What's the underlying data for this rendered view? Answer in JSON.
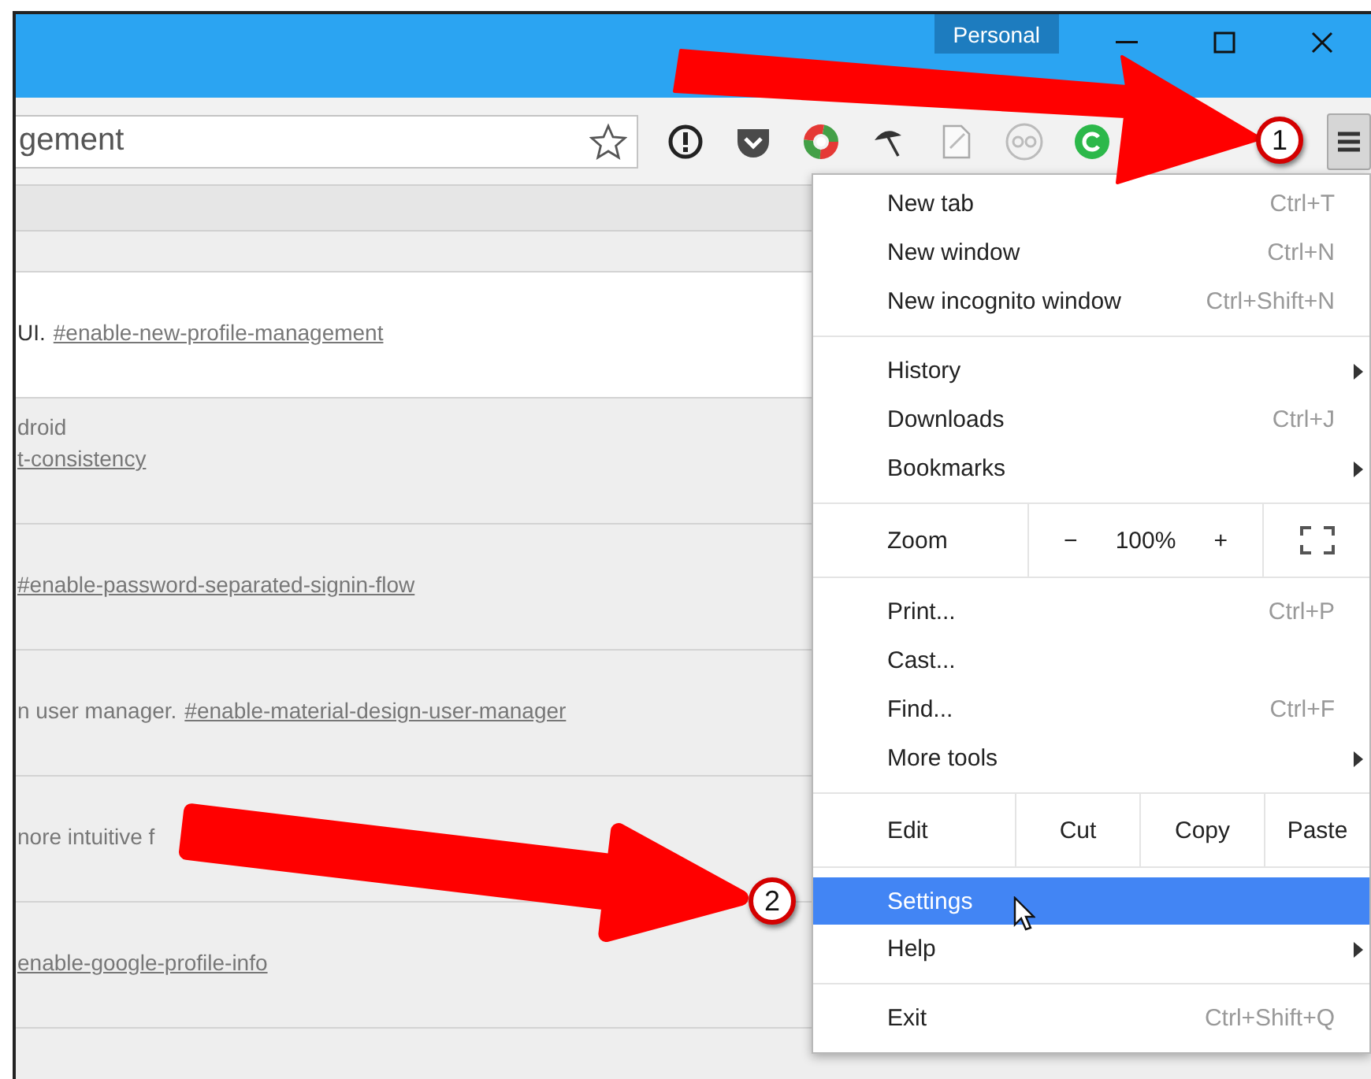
{
  "title_bar": {
    "profile": "Personal"
  },
  "toolbar": {
    "omnibox": {
      "value": "gement"
    }
  },
  "flags": [
    {
      "highlighted": true,
      "lines": [
        [
          {
            "kind": "text",
            "text": "UI."
          },
          {
            "kind": "link",
            "text": "#enable-new-profile-management"
          }
        ]
      ]
    },
    {
      "highlighted": false,
      "lines": [
        [
          {
            "kind": "text",
            "text": "droid"
          }
        ],
        [
          {
            "kind": "link",
            "text": "t-consistency"
          }
        ]
      ]
    },
    {
      "highlighted": false,
      "lines": [
        [
          {
            "kind": "link",
            "text": "#enable-password-separated-signin-flow"
          }
        ]
      ]
    },
    {
      "highlighted": false,
      "lines": [
        [
          {
            "kind": "text",
            "text": "n user manager."
          },
          {
            "kind": "link",
            "text": "#enable-material-design-user-manager"
          }
        ]
      ]
    },
    {
      "highlighted": false,
      "lines": [
        [
          {
            "kind": "text",
            "text": "nore intuitive f"
          }
        ]
      ]
    },
    {
      "highlighted": false,
      "lines": [
        [
          {
            "kind": "link",
            "text": "enable-google-profile-info"
          }
        ]
      ]
    }
  ],
  "menu": {
    "sections": [
      {
        "items": [
          {
            "kind": "item",
            "label": "New tab",
            "shortcut": "Ctrl+T",
            "submenu": false,
            "selected": false
          },
          {
            "kind": "item",
            "label": "New window",
            "shortcut": "Ctrl+N",
            "submenu": false,
            "selected": false
          },
          {
            "kind": "item",
            "label": "New incognito window",
            "shortcut": "Ctrl+Shift+N",
            "submenu": false,
            "selected": false
          }
        ]
      },
      {
        "items": [
          {
            "kind": "item",
            "label": "History",
            "submenu": true,
            "selected": false
          },
          {
            "kind": "item",
            "label": "Downloads",
            "shortcut": "Ctrl+J",
            "submenu": false,
            "selected": false
          },
          {
            "kind": "item",
            "label": "Bookmarks",
            "submenu": true,
            "selected": false
          }
        ]
      },
      {
        "items": [
          {
            "kind": "zoom",
            "label": "Zoom",
            "decrease": "−",
            "value": "100%",
            "increase": "+"
          }
        ]
      },
      {
        "items": [
          {
            "kind": "item",
            "label": "Print...",
            "shortcut": "Ctrl+P",
            "submenu": false,
            "selected": false
          },
          {
            "kind": "item",
            "label": "Cast...",
            "submenu": false,
            "selected": false
          },
          {
            "kind": "item",
            "label": "Find...",
            "shortcut": "Ctrl+F",
            "submenu": false,
            "selected": false
          },
          {
            "kind": "item",
            "label": "More tools",
            "submenu": true,
            "selected": false
          }
        ]
      },
      {
        "items": [
          {
            "kind": "edit",
            "label": "Edit",
            "actions": [
              "Cut",
              "Copy",
              "Paste"
            ]
          }
        ]
      },
      {
        "items": [
          {
            "kind": "item",
            "label": "Settings",
            "submenu": false,
            "selected": true
          },
          {
            "kind": "item",
            "label": "Help",
            "submenu": true,
            "selected": false
          }
        ]
      },
      {
        "items": [
          {
            "kind": "item",
            "label": "Exit",
            "shortcut": "Ctrl+Shift+Q",
            "submenu": false,
            "selected": false
          }
        ]
      }
    ]
  },
  "annotations": [
    {
      "label": "1"
    },
    {
      "label": "2"
    }
  ]
}
